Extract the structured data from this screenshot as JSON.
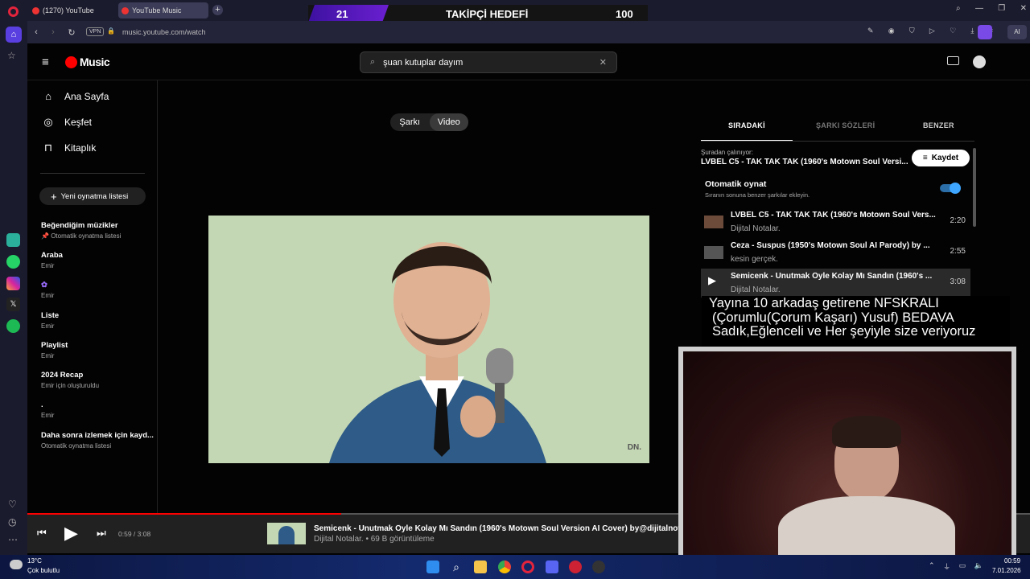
{
  "browser": {
    "tabs": [
      {
        "label": "(1270) YouTube"
      },
      {
        "label": "YouTube Music"
      }
    ],
    "address": "music.youtube.com/watch",
    "vpn_label": "VPN",
    "ai_label": "AI"
  },
  "stream_goal": {
    "left_value": "21",
    "title": "TAKİPÇİ HEDEFİ",
    "right_value": "100"
  },
  "app": {
    "logo": "Music",
    "search_value": "şuan kutuplar dayım"
  },
  "sidebar": {
    "nav": [
      {
        "label": "Ana Sayfa"
      },
      {
        "label": "Keşfet"
      },
      {
        "label": "Kitaplık"
      }
    ],
    "new_playlist": "Yeni oynatma listesi",
    "playlists": [
      {
        "title": "Beğendiğim müzikler",
        "sub": "Otomatik oynatma listesi"
      },
      {
        "title": "Araba",
        "sub": "Emir"
      },
      {
        "title": "",
        "sub": "Emir"
      },
      {
        "title": "Liste",
        "sub": "Emir"
      },
      {
        "title": "Playlist",
        "sub": "Emir"
      },
      {
        "title": "2024 Recap",
        "sub": "Emir için oluşturuldu"
      },
      {
        "title": ".",
        "sub": "Emir"
      },
      {
        "title": "Daha sonra izlemek için kayd...",
        "sub": "Otomatik oynatma listesi"
      }
    ]
  },
  "view_toggle": {
    "song": "Şarkı",
    "video": "Video"
  },
  "right_panel": {
    "tabs": [
      "SIRADAKİ",
      "ŞARKI SÖZLERİ",
      "BENZER"
    ],
    "playing_from_label": "Şuradan çalınıyor:",
    "playing_from_title": "LVBEL C5 - TAK TAK TAK (1960's Motown Soul Versi...",
    "save_label": "Kaydet",
    "autoplay_title": "Otomatik oynat",
    "autoplay_sub": "Sıranın sonuna benzer şarkılar ekleyin.",
    "autoplay_on": true,
    "queue": [
      {
        "title": "LVBEL C5 - TAK TAK TAK (1960's Motown Soul Vers...",
        "artist": "Dijital Notalar.",
        "duration": "2:20"
      },
      {
        "title": "Ceza - Suspus (1950's Motown Soul AI Parody) by ...",
        "artist": "kesin gerçek.",
        "duration": "2:55"
      },
      {
        "title": "Semicenk - Unutmak Öyle Kolay Mı Sandın (1960's ...",
        "artist": "Dijital Notalar.",
        "duration": "3:08"
      }
    ]
  },
  "stream_overlay": {
    "line1": "Yayına 10 arkadaş getirene NFSKRALI",
    "line2": "(Çorumlu(Çorum Kaşarı) Yusuf) BEDAVA",
    "line3": "Sadık,Eğlenceli ve Her şeyiyle size veriyoruz"
  },
  "player": {
    "time": "0:59 / 3:08",
    "progress_fraction": 0.313,
    "title": "Semicenk - Unutmak Öyle Kolay Mı Sandın (1960's Motown Soul Version AI Cover) by@dijitalnota",
    "meta": "Dijital Notalar. • 69 B görüntüleme"
  },
  "video_watermark": "DN.",
  "taskbar": {
    "weather_temp": "13°C",
    "weather_desc": "Çok bulutlu",
    "time": "00:59",
    "date": "7.01.2026"
  },
  "colors": {
    "accent": "#ff0000",
    "toggle": "#3ea6ff",
    "goal_purple": "#6a1fd0"
  }
}
